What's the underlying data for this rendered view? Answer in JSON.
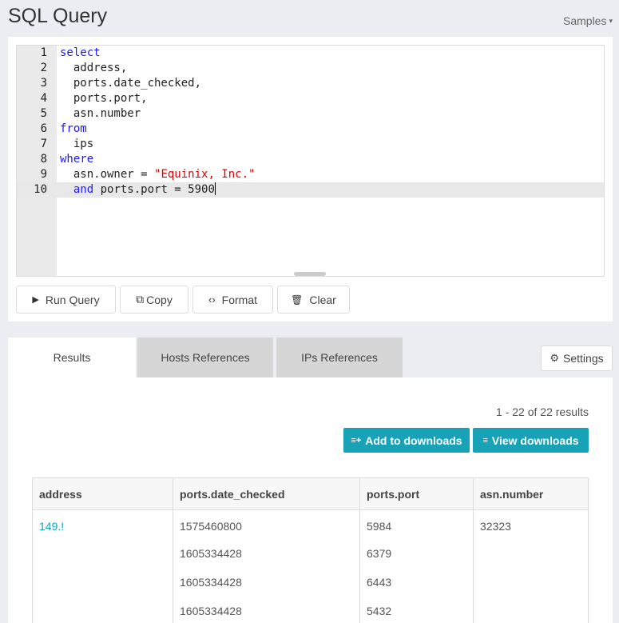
{
  "header": {
    "title": "SQL Query",
    "samples_label": "Samples",
    "samples_caret": "▾"
  },
  "editor": {
    "lines": [
      {
        "num": "1",
        "segments": [
          {
            "t": "select",
            "c": "kw"
          }
        ]
      },
      {
        "num": "2",
        "segments": [
          {
            "t": "  address,",
            "c": ""
          }
        ]
      },
      {
        "num": "3",
        "segments": [
          {
            "t": "  ports.date_checked,",
            "c": ""
          }
        ]
      },
      {
        "num": "4",
        "segments": [
          {
            "t": "  ports.port,",
            "c": ""
          }
        ]
      },
      {
        "num": "5",
        "segments": [
          {
            "t": "  asn.number",
            "c": ""
          }
        ]
      },
      {
        "num": "6",
        "segments": [
          {
            "t": "from",
            "c": "kw"
          }
        ]
      },
      {
        "num": "7",
        "segments": [
          {
            "t": "  ips",
            "c": ""
          }
        ]
      },
      {
        "num": "8",
        "segments": [
          {
            "t": "where",
            "c": "kw"
          }
        ]
      },
      {
        "num": "9",
        "segments": [
          {
            "t": "  asn.owner = ",
            "c": ""
          },
          {
            "t": "\"Equinix, Inc.\"",
            "c": "str"
          }
        ]
      },
      {
        "num": "10",
        "segments": [
          {
            "t": "  ",
            "c": ""
          },
          {
            "t": "and",
            "c": "kw"
          },
          {
            "t": " ports.port = 5900",
            "c": ""
          }
        ],
        "active": true
      }
    ]
  },
  "toolbar": {
    "run_label": "Run Query",
    "run_icon": "▶",
    "copy_label": "Copy",
    "copy_icon": "⧉",
    "format_label": "Format",
    "format_icon": "‹›",
    "clear_label": "Clear",
    "clear_icon": "🗑"
  },
  "tabs": [
    {
      "label": "Results"
    },
    {
      "label": "Hosts References"
    },
    {
      "label": "IPs References"
    }
  ],
  "settings": {
    "label": "Settings",
    "icon": "⚙"
  },
  "results": {
    "count_text": "1 - 22 of 22 results",
    "add_label": "Add to downloads",
    "add_icon": "≡+",
    "view_label": "View downloads",
    "view_icon": "≡",
    "columns": [
      "address",
      "ports.date_checked",
      "ports.port",
      "asn.number"
    ],
    "rows": [
      [
        "149.!",
        "1575460800",
        "5984",
        "32323"
      ],
      [
        "",
        "1605334428",
        "6379",
        ""
      ],
      [
        "",
        "1605334428",
        "6443",
        ""
      ],
      [
        "",
        "1605334428",
        "5432",
        ""
      ]
    ]
  },
  "colors": {
    "accent": "#17a2b8",
    "keyword": "#1a1aff",
    "string": "#dd0000"
  }
}
